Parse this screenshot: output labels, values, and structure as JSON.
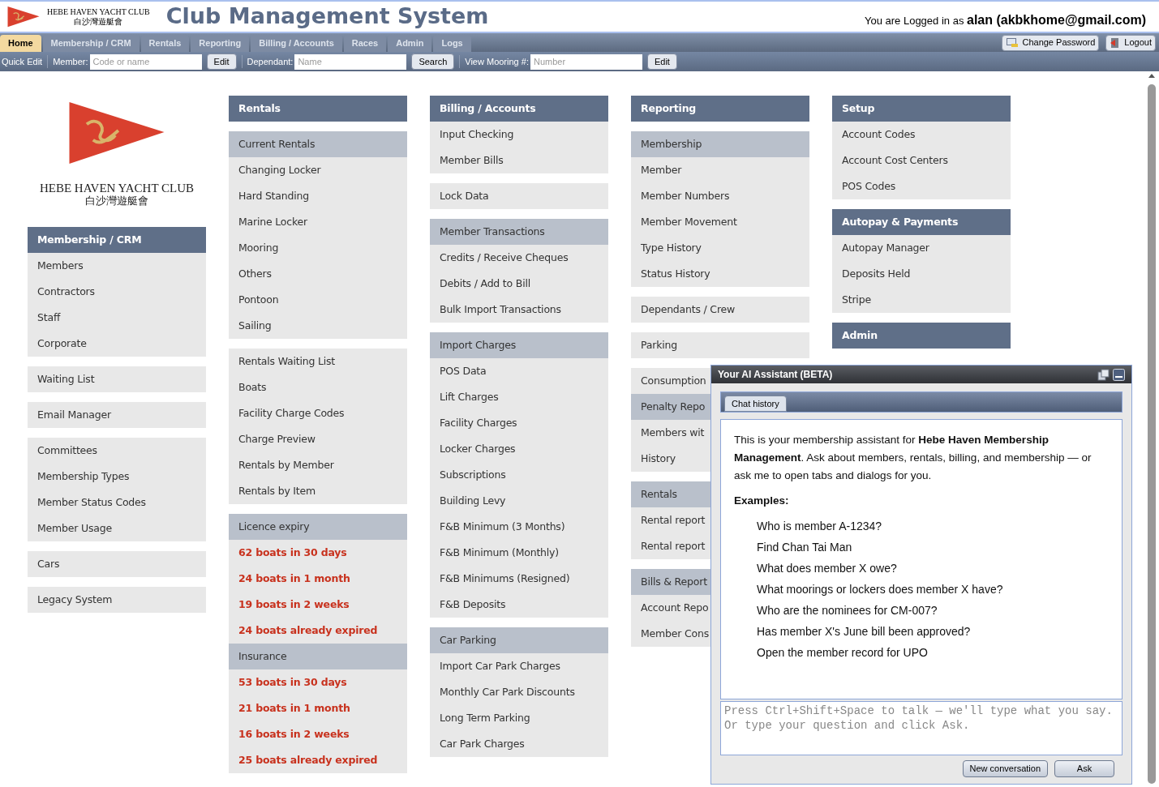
{
  "header": {
    "club_name": "HEBE HAVEN YACHT CLUB",
    "club_name_zh": "白沙灣遊艇會",
    "title": "Club Management System",
    "login": "You are Logged in as **alan (akbkhome@gmail.com)**"
  },
  "nav_tabs": [
    {
      "label": "Home",
      "selected": true
    },
    {
      "label": "Membership / CRM",
      "selected": false
    },
    {
      "label": "Rentals",
      "selected": false
    },
    {
      "label": "Reporting",
      "selected": false
    },
    {
      "label": "Billing / Accounts",
      "selected": false
    },
    {
      "label": "Races",
      "selected": false
    },
    {
      "label": "Admin",
      "selected": false
    },
    {
      "label": "Logs",
      "selected": false
    }
  ],
  "nav_buttons": [
    {
      "label": "Change Password",
      "kind": "password"
    },
    {
      "label": "Logout",
      "kind": "logout"
    }
  ],
  "quick_edit": {
    "label": "Quick Edit",
    "fields": [
      {
        "label": "Member:",
        "placeholder": "Code or name",
        "button": "Edit"
      },
      {
        "label": "Dependant:",
        "placeholder": "Name",
        "button": "Search"
      },
      {
        "label": "View Mooring #:",
        "placeholder": "Number",
        "button": "Edit"
      }
    ]
  },
  "logo": {
    "name": "HEBE HAVEN YACHT CLUB",
    "name_zh": "白沙灣遊艇會"
  },
  "menu_columns": [
    {
      "blocks": [
        {
          "rows": [
            {
              "kind": "header",
              "text": "Membership / CRM"
            },
            {
              "kind": "item",
              "text": "Members"
            },
            {
              "kind": "item",
              "text": "Contractors"
            },
            {
              "kind": "item",
              "text": "Staff"
            },
            {
              "kind": "item",
              "text": "Corporate"
            }
          ]
        },
        {
          "rows": [
            {
              "kind": "item",
              "text": "Waiting List"
            }
          ]
        },
        {
          "rows": [
            {
              "kind": "item",
              "text": "Email Manager"
            }
          ]
        },
        {
          "rows": [
            {
              "kind": "item",
              "text": "Committees"
            },
            {
              "kind": "item",
              "text": "Membership Types"
            },
            {
              "kind": "item",
              "text": "Member Status Codes"
            },
            {
              "kind": "item",
              "text": "Member Usage"
            }
          ]
        },
        {
          "rows": [
            {
              "kind": "item",
              "text": "Cars"
            }
          ]
        },
        {
          "rows": [
            {
              "kind": "item",
              "text": "Legacy System"
            }
          ]
        }
      ]
    },
    {
      "blocks": [
        {
          "rows": [
            {
              "kind": "header",
              "text": "Rentals"
            }
          ]
        },
        {
          "rows": [
            {
              "kind": "subheader",
              "text": "Current Rentals"
            },
            {
              "kind": "item",
              "text": "Changing Locker"
            },
            {
              "kind": "item",
              "text": "Hard Standing"
            },
            {
              "kind": "item",
              "text": "Marine Locker"
            },
            {
              "kind": "item",
              "text": "Mooring"
            },
            {
              "kind": "item",
              "text": "Others"
            },
            {
              "kind": "item",
              "text": "Pontoon"
            },
            {
              "kind": "item",
              "text": "Sailing"
            }
          ]
        },
        {
          "rows": [
            {
              "kind": "item",
              "text": "Rentals Waiting List"
            },
            {
              "kind": "item",
              "text": "Boats"
            },
            {
              "kind": "item",
              "text": "Facility Charge Codes"
            },
            {
              "kind": "item",
              "text": "Charge Preview"
            },
            {
              "kind": "item",
              "text": "Rentals by Member"
            },
            {
              "kind": "item",
              "text": "Rentals by Item"
            }
          ]
        },
        {
          "rows": [
            {
              "kind": "subheader",
              "text": "Licence expiry"
            },
            {
              "kind": "alert",
              "text": "62 boats in 30 days"
            },
            {
              "kind": "alert",
              "text": "24 boats in 1 month"
            },
            {
              "kind": "alert",
              "text": "19 boats in 2 weeks"
            },
            {
              "kind": "alert",
              "text": "24 boats already expired"
            },
            {
              "kind": "subheader",
              "text": "Insurance"
            },
            {
              "kind": "alert",
              "text": "53 boats in 30 days"
            },
            {
              "kind": "alert",
              "text": "21 boats in 1 month"
            },
            {
              "kind": "alert",
              "text": "16 boats in 2 weeks"
            },
            {
              "kind": "alert",
              "text": "25 boats already expired"
            }
          ]
        }
      ]
    },
    {
      "blocks": [
        {
          "rows": [
            {
              "kind": "header",
              "text": "Billing / Accounts"
            },
            {
              "kind": "item",
              "text": "Input Checking"
            },
            {
              "kind": "item",
              "text": "Member Bills"
            }
          ]
        },
        {
          "rows": [
            {
              "kind": "item",
              "text": "Lock Data"
            }
          ]
        },
        {
          "rows": [
            {
              "kind": "subheader",
              "text": "Member Transactions"
            },
            {
              "kind": "item",
              "text": "Credits / Receive Cheques"
            },
            {
              "kind": "item",
              "text": "Debits / Add to Bill"
            },
            {
              "kind": "item",
              "text": "Bulk Import Transactions"
            }
          ]
        },
        {
          "rows": [
            {
              "kind": "subheader",
              "text": "Import Charges"
            },
            {
              "kind": "item",
              "text": "POS Data"
            },
            {
              "kind": "item",
              "text": "Lift Charges"
            },
            {
              "kind": "item",
              "text": "Facility Charges"
            },
            {
              "kind": "item",
              "text": "Locker Charges"
            },
            {
              "kind": "item",
              "text": "Subscriptions"
            },
            {
              "kind": "item",
              "text": "Building Levy"
            },
            {
              "kind": "item",
              "text": "F&B Minimum (3 Months)"
            },
            {
              "kind": "item",
              "text": "F&B Minimum (Monthly)"
            },
            {
              "kind": "item",
              "text": "F&B Minimums (Resigned)"
            },
            {
              "kind": "item",
              "text": "F&B Deposits"
            }
          ]
        },
        {
          "rows": [
            {
              "kind": "subheader",
              "text": "Car Parking"
            },
            {
              "kind": "item",
              "text": "Import Car Park Charges"
            },
            {
              "kind": "item",
              "text": "Monthly Car Park Discounts"
            },
            {
              "kind": "item",
              "text": "Long Term Parking"
            },
            {
              "kind": "item",
              "text": "Car Park Charges"
            }
          ]
        }
      ]
    },
    {
      "blocks": [
        {
          "rows": [
            {
              "kind": "header",
              "text": "Reporting"
            }
          ]
        },
        {
          "rows": [
            {
              "kind": "subheader",
              "text": "Membership"
            },
            {
              "kind": "item",
              "text": "Member"
            },
            {
              "kind": "item",
              "text": "Member Numbers"
            },
            {
              "kind": "item",
              "text": "Member Movement"
            },
            {
              "kind": "item",
              "text": "Type History"
            },
            {
              "kind": "item",
              "text": "Status History"
            }
          ]
        },
        {
          "rows": [
            {
              "kind": "item",
              "text": "Dependants / Crew"
            }
          ]
        },
        {
          "rows": [
            {
              "kind": "item",
              "text": "Parking"
            }
          ]
        },
        {
          "rows": [
            {
              "kind": "item",
              "text": "Consumption"
            },
            {
              "kind": "subheader",
              "text": "Penalty Repo"
            },
            {
              "kind": "item",
              "text": "Members wit"
            },
            {
              "kind": "item",
              "text": "History"
            }
          ]
        },
        {
          "rows": [
            {
              "kind": "subheader",
              "text": "Rentals"
            },
            {
              "kind": "item",
              "text": "Rental report"
            },
            {
              "kind": "item",
              "text": "Rental report"
            }
          ]
        },
        {
          "rows": [
            {
              "kind": "subheader",
              "text": "Bills & Report"
            },
            {
              "kind": "item",
              "text": "Account Repo"
            },
            {
              "kind": "item",
              "text": "Member Cons"
            }
          ]
        }
      ]
    },
    {
      "blocks": [
        {
          "rows": [
            {
              "kind": "header",
              "text": "Setup"
            },
            {
              "kind": "item",
              "text": "Account Codes"
            },
            {
              "kind": "item",
              "text": "Account Cost Centers"
            },
            {
              "kind": "item",
              "text": "POS Codes"
            }
          ]
        },
        {
          "rows": [
            {
              "kind": "header",
              "text": "Autopay & Payments"
            },
            {
              "kind": "item",
              "text": "Autopay Manager"
            },
            {
              "kind": "item",
              "text": "Deposits Held"
            },
            {
              "kind": "item",
              "text": "Stripe"
            }
          ]
        },
        {
          "rows": [
            {
              "kind": "header",
              "text": "Admin"
            }
          ]
        }
      ]
    }
  ],
  "assistant": {
    "title": "Your AI Assistant (BETA)",
    "tabs": [
      {
        "label": "Chat history",
        "selected": true
      }
    ],
    "intro": "This is your membership assistant for **Hebe Haven Membership Management**. Ask about members, rentals, billing, and membership — or ask me to open tabs and dialogs for you.",
    "examples_heading": "Examples:",
    "examples": [
      "Who is member A-1234?",
      "Find Chan Tai Man",
      "What does member X owe?",
      "What moorings or lockers does member X have?",
      "Who are the nominees for CM-007?",
      "Has member X's June bill been approved?",
      "Open the member record for UPO"
    ],
    "input": {
      "placeholder": "Press Ctrl+Shift+Space to talk — we'll type what you say. Or type your question and click Ask."
    },
    "buttons": [
      "New conversation",
      "Ask"
    ]
  }
}
